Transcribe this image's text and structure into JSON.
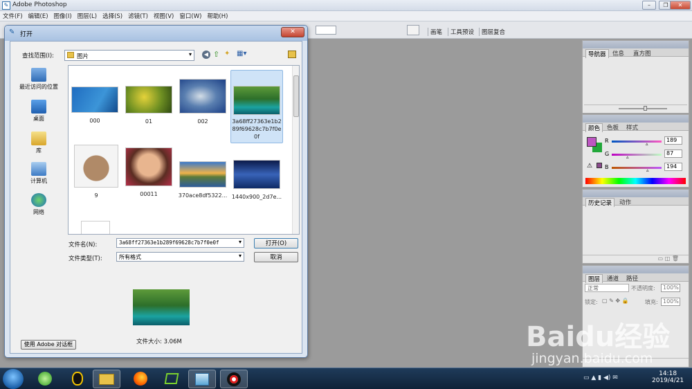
{
  "app": {
    "title": "Adobe Photoshop"
  },
  "menu": [
    "文件(F)",
    "编辑(E)",
    "图像(I)",
    "图层(L)",
    "选择(S)",
    "滤镜(T)",
    "视图(V)",
    "窗口(W)",
    "帮助(H)"
  ],
  "options_bar": {
    "tabs": [
      "画笔",
      "工具预设",
      "图层复合"
    ]
  },
  "dialog": {
    "title": "打开",
    "look_in_label": "查找范围(I):",
    "look_in_value": "图片",
    "places": [
      "最近访问的位置",
      "桌面",
      "库",
      "计算机",
      "网络"
    ],
    "files": [
      {
        "name": "000"
      },
      {
        "name": "01"
      },
      {
        "name": "002"
      },
      {
        "name": "3a68ff27363e1b289f69628c7b7f0e0f"
      },
      {
        "name": "9"
      },
      {
        "name": "00011"
      },
      {
        "name": "370ace8df5322..."
      },
      {
        "name": "1440x900_2d7e..."
      }
    ],
    "filename_label": "文件名(N):",
    "filename_value": "3a68ff27363e1b289f69628c7b7f0e0f",
    "filetype_label": "文件类型(T):",
    "filetype_value": "所有格式",
    "open_button": "打开(O)",
    "cancel_button": "取消",
    "file_size": "文件大小: 3.06M",
    "adobe_dialog_button": "使用 Adobe 对话框"
  },
  "panels": {
    "navigator_tabs": [
      "导航器",
      "信息",
      "直方图"
    ],
    "color_tabs": [
      "颜色",
      "色板",
      "样式"
    ],
    "color": {
      "r_label": "R",
      "g_label": "G",
      "b_label": "B",
      "r": "189",
      "g": "87",
      "b": "194",
      "foreground": "#bd57c2",
      "background": "#22a83a"
    },
    "history_tabs": [
      "历史记录",
      "动作"
    ],
    "layers_tabs": [
      "图层",
      "通道",
      "路径"
    ],
    "layers": {
      "blend_mode": "正常",
      "opacity_label": "不透明度:",
      "opacity": "100%",
      "lock_label": "锁定:",
      "fill_label": "填充:",
      "fill": "100%"
    }
  },
  "taskbar": {
    "apps": [
      "start-orb",
      "360-browser",
      "qq",
      "file-explorer",
      "firefox",
      "media-player",
      "photoshop",
      "screen-recorder"
    ],
    "time": "14:18",
    "date": "2019/4/21"
  },
  "watermark": {
    "brand": "Baidu经验",
    "url": "jingyan.baidu.com"
  }
}
